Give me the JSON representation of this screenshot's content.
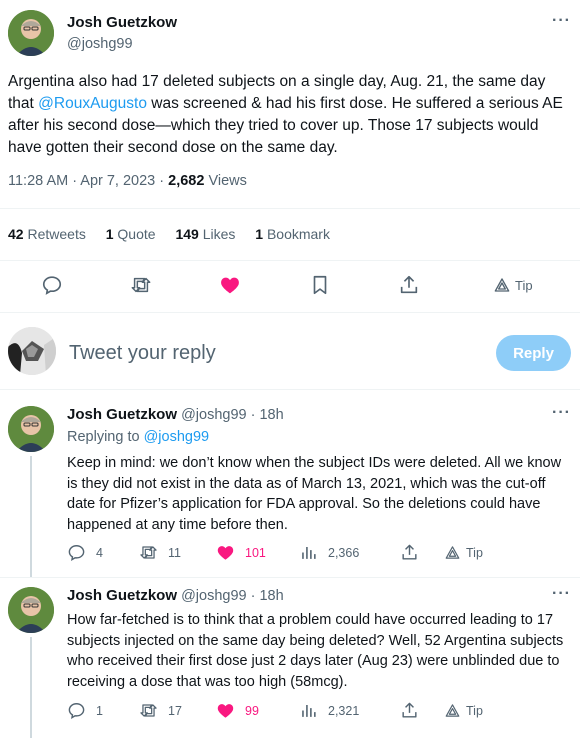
{
  "main_tweet": {
    "author_name": "Josh Guetzkow",
    "author_handle": "@joshg99",
    "text_before_mention": "Argentina also had 17 deleted subjects on a single day, Aug. 21, the same day that ",
    "mention": "@RouxAugusto",
    "text_after_mention": " was screened & had his first dose. He suffered a serious AE after his second dose—which they tried to cover up. Those 17 subjects would have gotten their second dose on the same day.",
    "timestamp": "11:28 AM · Apr 7, 2023",
    "separator": " · ",
    "views_count": "2,682",
    "views_label": "Views",
    "stats": {
      "retweets_count": "42",
      "retweets_label": "Retweets",
      "quotes_count": "1",
      "quotes_label": "Quote",
      "likes_count": "149",
      "likes_label": "Likes",
      "bookmarks_count": "1",
      "bookmarks_label": "Bookmark"
    },
    "tip_label": "Tip"
  },
  "compose": {
    "placeholder": "Tweet your reply",
    "button_label": "Reply"
  },
  "replies": [
    {
      "author_name": "Josh Guetzkow",
      "author_handle": "@joshg99",
      "time": "· 18h",
      "replying_to_label": "Replying to ",
      "replying_to_handle": "@joshg99",
      "text": "Keep in mind: we don’t know when the subject IDs were deleted. All we know is they did not exist in the data as of March 13, 2021, which was the cut-off date for Pfizer’s application for FDA approval. So the deletions could have happened at any time before then.",
      "replies_count": "4",
      "retweets_count": "11",
      "likes_count": "101",
      "views_count": "2,366",
      "tip_label": "Tip"
    },
    {
      "author_name": "Josh Guetzkow",
      "author_handle": "@joshg99",
      "time": "· 18h",
      "text": "How far-fetched is to think that a problem could have occurred leading to 17 subjects injected on the same day being deleted? Well, 52 Argentina subjects who received their first dose just 2 days later (Aug 23) were unblinded due to receiving a dose that was too high (58mcg).",
      "replies_count": "1",
      "retweets_count": "17",
      "likes_count": "99",
      "views_count": "2,321",
      "tip_label": "Tip"
    }
  ],
  "colors": {
    "accent": "#1d9bf0",
    "like": "#f91880",
    "muted": "#536471",
    "reply_button": "#8ecdf8"
  }
}
